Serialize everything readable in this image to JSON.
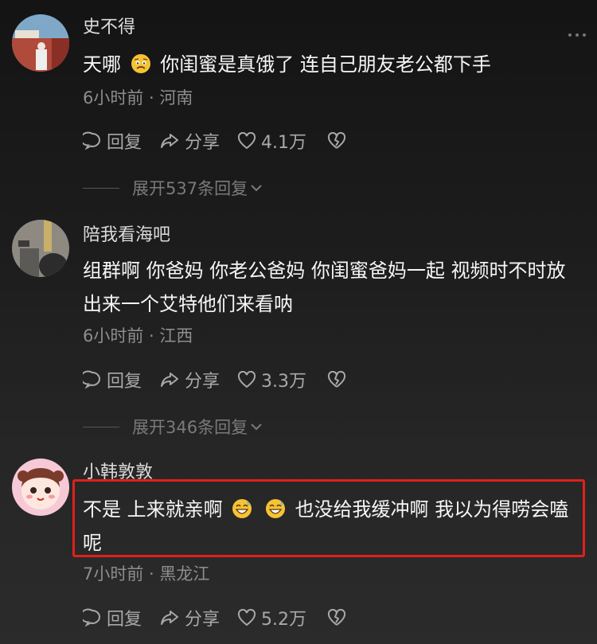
{
  "comments": [
    {
      "username": "史不得",
      "text_before": "天哪",
      "text_after": "你闺蜜是真饿了 连自己朋友老公都下手",
      "meta": "6小时前 · 河南",
      "reply_label": "回复",
      "share_label": "分享",
      "like_count": "4.1万",
      "expand_label": "展开537条回复"
    },
    {
      "username": "陪我看海吧",
      "text": "组群啊 你爸妈 你老公爸妈 你闺蜜爸妈一起 视频时不时放出来一个艾特他们来看呐",
      "meta": "6小时前 · 江西",
      "reply_label": "回复",
      "share_label": "分享",
      "like_count": "3.3万",
      "expand_label": "展开346条回复"
    },
    {
      "username": "小韩敦敦",
      "text_part1": "不是 上来就亲啊",
      "text_part2": "也没给我缓冲啊 我以为得唠会嗑呢",
      "meta": "7小时前 · 黑龙江",
      "reply_label": "回复",
      "share_label": "分享",
      "like_count": "5.2万"
    }
  ],
  "colors": {
    "highlight_border": "#e0201c",
    "background": "#1d1d1d"
  }
}
